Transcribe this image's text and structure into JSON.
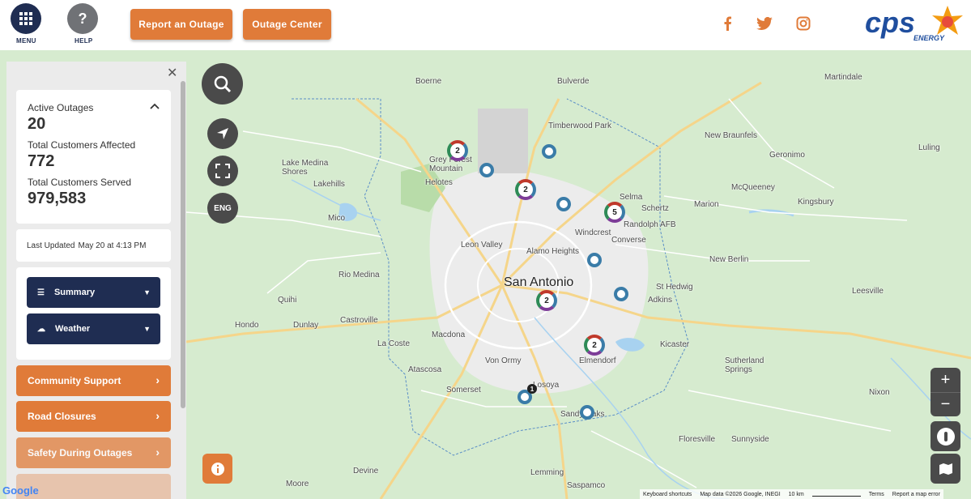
{
  "header": {
    "menu_label": "MENU",
    "help_label": "HELP",
    "report_outage_label": "Report an Outage",
    "outage_center_label": "Outage Center",
    "logo_text": "cps",
    "logo_subtext": "ENERGY",
    "brand_color": "#1f2d52",
    "accent_color": "#e07b39",
    "social_icons": [
      "facebook-icon",
      "twitter-icon",
      "instagram-icon"
    ]
  },
  "summary": {
    "active_outages_label": "Active Outages",
    "active_outages": "20",
    "customers_affected_label": "Total Customers Affected",
    "customers_affected": "772",
    "customers_served_label": "Total Customers Served",
    "customers_served": "979,583",
    "last_updated_label": "Last Updated",
    "last_updated": "May 20 at 4:13 PM"
  },
  "filters": {
    "summary_label": "Summary",
    "weather_label": "Weather"
  },
  "links": [
    {
      "label": "Community Support"
    },
    {
      "label": "Road Closures"
    },
    {
      "label": "Safety During Outages"
    }
  ],
  "map_controls": {
    "language_label": "ENG"
  },
  "places": [
    {
      "name": "Boerne"
    },
    {
      "name": "Bulverde"
    },
    {
      "name": "Timberwood Park"
    },
    {
      "name": "New Braunfels"
    },
    {
      "name": "Martindale"
    },
    {
      "name": "Geronimo"
    },
    {
      "name": "Luling"
    },
    {
      "name": "McQueeney"
    },
    {
      "name": "Lake Medina Shores"
    },
    {
      "name": "Lakehills"
    },
    {
      "name": "Mico"
    },
    {
      "name": "Helotes"
    },
    {
      "name": "Grey Forest Mountain"
    },
    {
      "name": "Selma"
    },
    {
      "name": "Schertz"
    },
    {
      "name": "Randolph AFB"
    },
    {
      "name": "Marion"
    },
    {
      "name": "Kingsbury"
    },
    {
      "name": "Leon Valley"
    },
    {
      "name": "Windcrest"
    },
    {
      "name": "Converse"
    },
    {
      "name": "Alamo Heights"
    },
    {
      "name": "New Berlin"
    },
    {
      "name": "Rio Medina"
    },
    {
      "name": "San Antonio"
    },
    {
      "name": "St Hedwig"
    },
    {
      "name": "Quihi"
    },
    {
      "name": "Castroville"
    },
    {
      "name": "Adkins"
    },
    {
      "name": "Hondo"
    },
    {
      "name": "Dunlay"
    },
    {
      "name": "La Coste"
    },
    {
      "name": "Macdona"
    },
    {
      "name": "Von Ormy"
    },
    {
      "name": "Elmendorf"
    },
    {
      "name": "Kicaster"
    },
    {
      "name": "Sutherland Springs"
    },
    {
      "name": "Leesville"
    },
    {
      "name": "Nixon"
    },
    {
      "name": "Atascosa"
    },
    {
      "name": "Somerset"
    },
    {
      "name": "Losoya"
    },
    {
      "name": "Sandy Oaks"
    },
    {
      "name": "Floresville"
    },
    {
      "name": "Sunnyside"
    },
    {
      "name": "Lemming"
    },
    {
      "name": "Moore"
    },
    {
      "name": "Saspamco"
    },
    {
      "name": "Devine"
    }
  ],
  "clusters": [
    {
      "count": "2"
    },
    {
      "count": "2"
    },
    {
      "count": "5"
    },
    {
      "count": "2"
    },
    {
      "count": "2"
    }
  ],
  "map_footer": {
    "google": "Google",
    "shortcuts": "Keyboard shortcuts",
    "attribution": "Map data ©2026 Google, INEGI",
    "scale": "10 km",
    "terms": "Terms",
    "report": "Report a map error"
  }
}
